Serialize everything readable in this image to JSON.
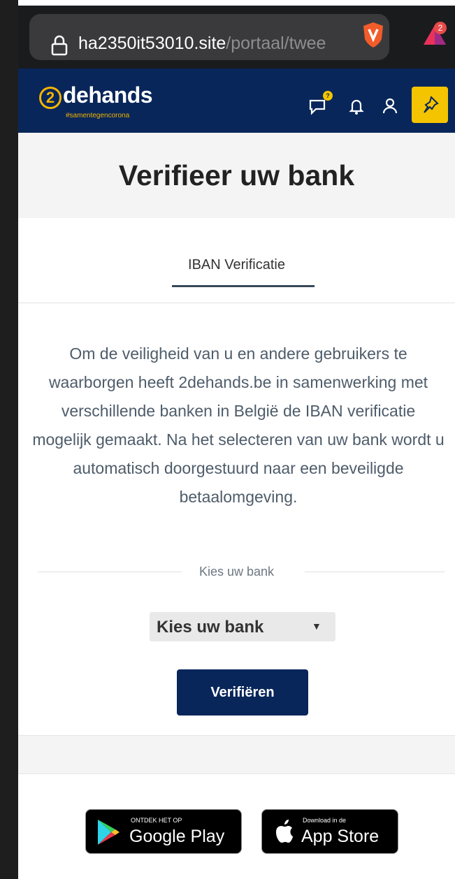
{
  "browser": {
    "url_host": "ha2350it53010.site",
    "url_path": "/portaal/twee",
    "rewards_count": "2"
  },
  "header": {
    "logo_number": "2",
    "logo_word": "dehands",
    "logo_tagline": "#samentegencorona",
    "chat_badge": "?",
    "icons": [
      "chat-icon",
      "bell-icon",
      "user-icon",
      "pin-icon"
    ],
    "accent_color": "#f4c400",
    "brand_color": "#08265a"
  },
  "page": {
    "title": "Verifieer uw bank",
    "tab_label": "IBAN Verificatie",
    "info_text": "Om de veiligheid van u en andere gebruikers te waarborgen heeft 2dehands.be in samenwerking met verschillende banken in België de IBAN verificatie mogelijk gemaakt. Na het selecteren van uw bank wordt u automatisch doorgestuurd naar een beveiligde betaalomgeving.",
    "divider_label": "Kies uw bank",
    "select_value": "Kies uw bank",
    "verify_label": "Verifiëren"
  },
  "footer": {
    "google_small": "ONTDEK HET OP",
    "google_big": "Google Play",
    "apple_small": "Download in de",
    "apple_big": "App Store"
  }
}
